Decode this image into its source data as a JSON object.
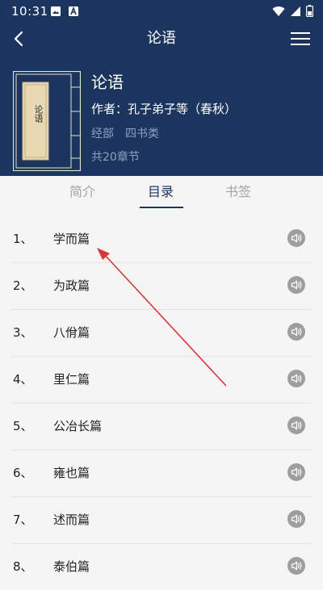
{
  "status_bar": {
    "time": "10:31"
  },
  "nav": {
    "title": "论语"
  },
  "book": {
    "cover_title": "论语",
    "title": "论语",
    "author": "作者：孔子弟子等（春秋）",
    "category_1": "经部",
    "category_2": "四书类",
    "chapter_count": "共20章节"
  },
  "tabs": [
    {
      "label": "简介"
    },
    {
      "label": "目录"
    },
    {
      "label": "书签"
    }
  ],
  "active_tab": "目录",
  "chapters": [
    {
      "num": "1、",
      "title": "学而篇"
    },
    {
      "num": "2、",
      "title": "为政篇"
    },
    {
      "num": "3、",
      "title": "八佾篇"
    },
    {
      "num": "4、",
      "title": "里仁篇"
    },
    {
      "num": "5、",
      "title": "公冶长篇"
    },
    {
      "num": "6、",
      "title": "雍也篇"
    },
    {
      "num": "7、",
      "title": "述而篇"
    },
    {
      "num": "8、",
      "title": "泰伯篇"
    }
  ],
  "colors": {
    "header": "#1c355e",
    "active_tab": "#1c355e",
    "inactive_tab": "#a3a3a3",
    "audio_icon": "#9e9e9e",
    "annotation_arrow": "#d9363e"
  },
  "icons": {
    "back": "chevron-left-icon",
    "menu": "hamburger-menu-icon",
    "audio": "speaker-icon"
  }
}
